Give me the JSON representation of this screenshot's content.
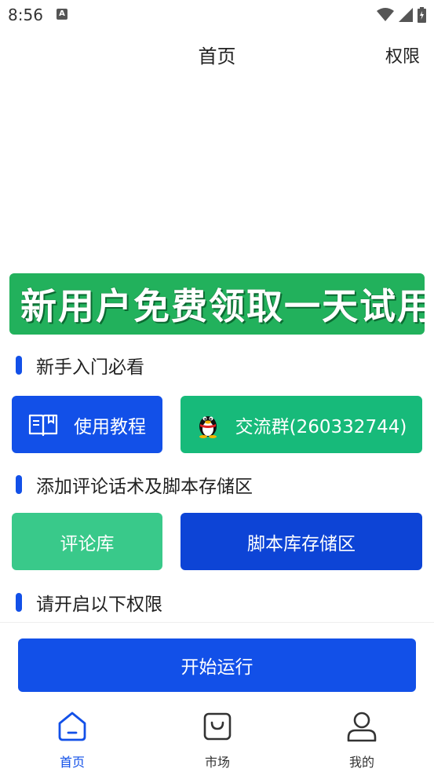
{
  "status_bar": {
    "time": "8:56",
    "notification_icon": "A",
    "icons": [
      "wifi-icon",
      "signal-icon",
      "battery-icon"
    ]
  },
  "header": {
    "title": "首页",
    "action": "权限"
  },
  "banner": {
    "text": "新用户免费领取一天试用",
    "icon": "pointing-hand-icon"
  },
  "sections": {
    "beginner": "新手入门必看",
    "add_comments": "添加评论话术及脚本存储区",
    "permissions": "请开启以下权限"
  },
  "buttons": {
    "tutorial": "使用教程",
    "group": "交流群(260332744)",
    "comment_library": "评论库",
    "script_storage": "脚本库存储区",
    "start": "开始运行"
  },
  "tabs": [
    {
      "label": "首页",
      "icon": "home-icon",
      "active": true
    },
    {
      "label": "市场",
      "icon": "shopping-bag-icon",
      "active": false
    },
    {
      "label": "我的",
      "icon": "user-icon",
      "active": false
    }
  ],
  "colors": {
    "primary": "#1250e8",
    "primary_dark": "#0d44d6",
    "green": "#17ba7a",
    "green_light": "#39c98a",
    "banner_green": "#22b15c"
  }
}
